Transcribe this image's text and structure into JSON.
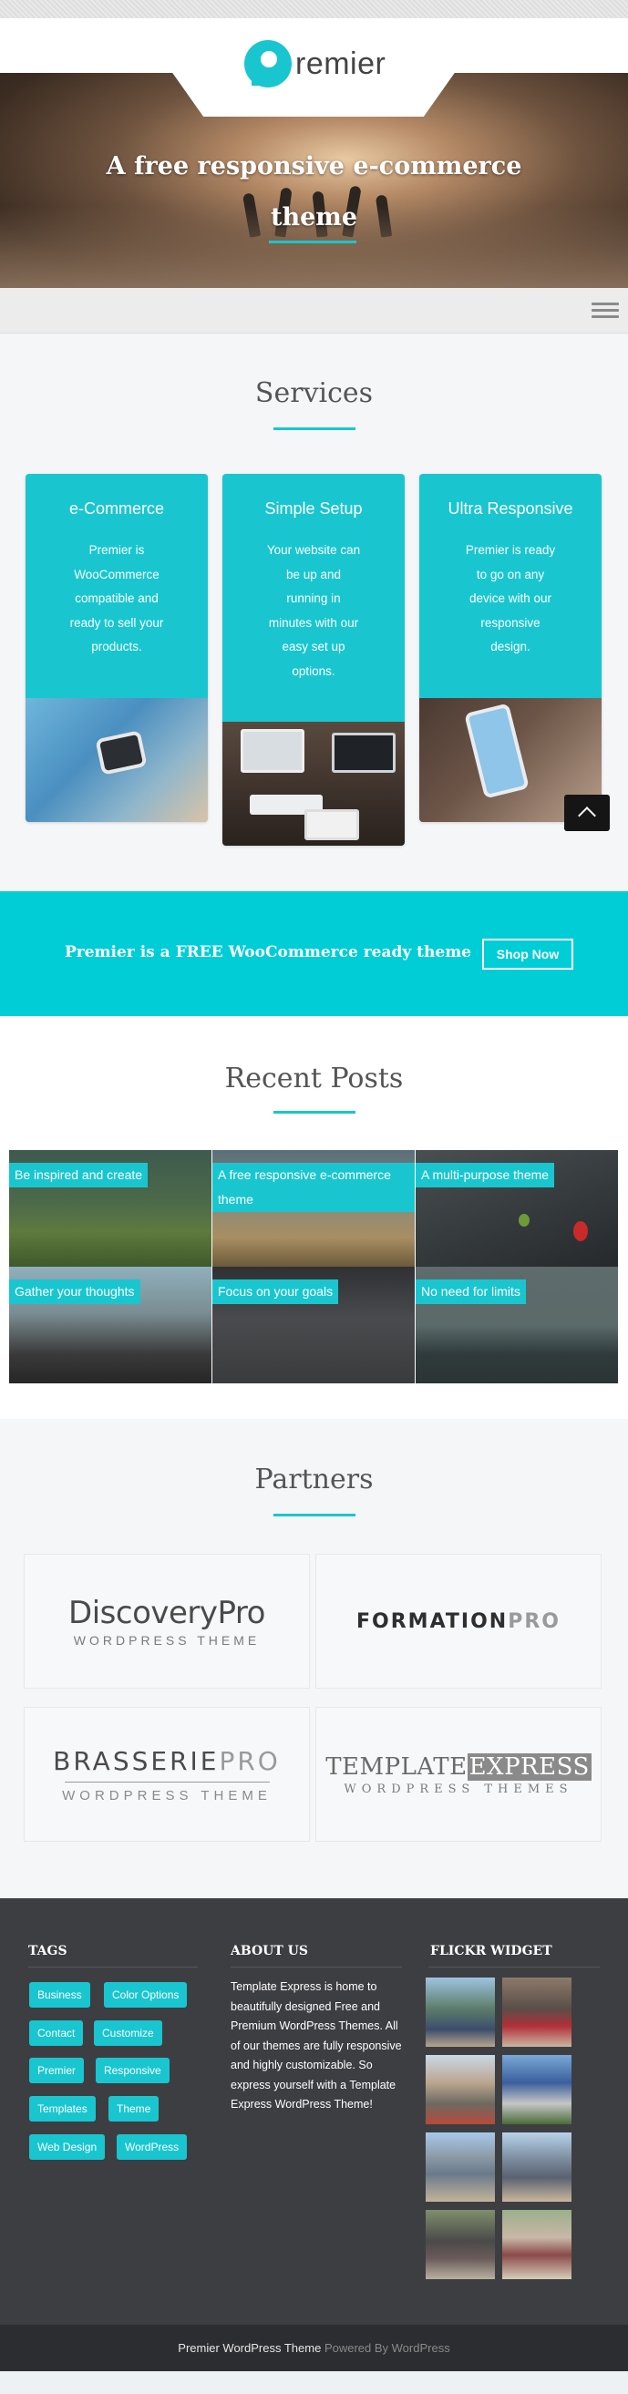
{
  "header": {
    "logo_text": "remier",
    "hero_title_line1": "A free responsive e-commerce",
    "hero_title_line2": "theme"
  },
  "services": {
    "title": "Services",
    "items": [
      {
        "title": "e-Commerce",
        "lines": [
          "Premier is",
          "WooCommerce",
          "compatible and",
          "ready to sell your",
          "products."
        ]
      },
      {
        "title": "Simple Setup",
        "lines": [
          "Your website can",
          "be up and",
          "running in",
          "minutes with our",
          "easy set up",
          "options."
        ]
      },
      {
        "title": "Ultra Responsive",
        "lines": [
          "Premier is ready",
          "to go on any",
          "device with our",
          "responsive",
          "design."
        ]
      }
    ]
  },
  "cta": {
    "text": "Premier is a FREE WooCommerce ready theme",
    "button": "Shop Now"
  },
  "recent_posts": {
    "title": "Recent Posts",
    "items": [
      {
        "label": "Be inspired and create"
      },
      {
        "label": "A free responsive e-commerce theme"
      },
      {
        "label": "A multi-purpose theme"
      },
      {
        "label": "Gather your thoughts"
      },
      {
        "label": "Focus on your goals"
      },
      {
        "label": "No need for limits"
      }
    ]
  },
  "partners": {
    "title": "Partners",
    "logos": [
      {
        "line1": "DiscoveryPro",
        "line2": "WORDPRESS THEME"
      },
      {
        "line1": "FORMATION",
        "line1b": "PRO"
      },
      {
        "line1": "BRASSERIE",
        "line1b": "PRO",
        "line2": "WORDPRESS THEME"
      },
      {
        "line1": "TEMPLATE",
        "line1b": "EXPRESS",
        "line2": "WORDPRESS THEMES"
      }
    ]
  },
  "footer": {
    "tags_title": "TAGS",
    "tags": [
      "Business",
      "Color Options",
      "Contact",
      "Customize",
      "Premier",
      "Responsive",
      "Templates",
      "Theme",
      "Web Design",
      "WordPress"
    ],
    "about_title": "ABOUT US",
    "about_text": "Template Express is home to beautifully designed Free and Premium WordPress Themes. All of our themes are fully responsive and highly customizable. So express yourself with a Template Express WordPress Theme!",
    "flickr_title": "FLICKR WIDGET",
    "credit_theme": "Premier WordPress Theme",
    "credit_powered": "Powered By WordPress"
  },
  "colors": {
    "accent": "#19c6cf",
    "cta_bg": "#00cdd6",
    "footer_bg": "#3d3e42"
  },
  "icons": {
    "menu": "hamburger-icon",
    "to_top": "chevron-up-icon",
    "logo": "premier-p-logo"
  }
}
